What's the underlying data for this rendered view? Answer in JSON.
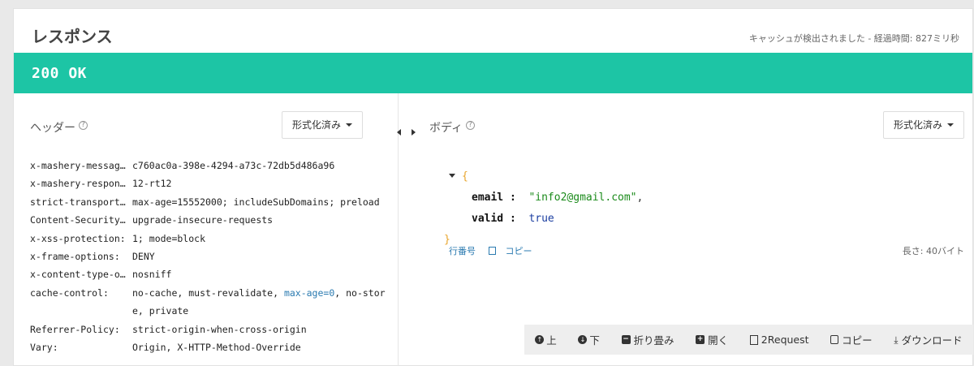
{
  "response": {
    "title": "レスポンス",
    "cache_message": "キャッシュが検出されました - 経過時間: 827ミリ秒",
    "status": "200 OK"
  },
  "headers_section": {
    "label": "ヘッダー",
    "help": "?",
    "format_button": "形式化済み",
    "rows": [
      {
        "key": "x-mashery-messag…",
        "value": "c760ac0a-398e-4294-a73c-72db5d486a96"
      },
      {
        "key": "x-mashery-respon…",
        "value": "12-rt12"
      },
      {
        "key": "strict-transport…",
        "value": "max-age=15552000; includeSubDomains; preload"
      },
      {
        "key": "Content-Security…",
        "value": "upgrade-insecure-requests"
      },
      {
        "key": "x-xss-protection:",
        "value": "1; mode=block"
      },
      {
        "key": "x-frame-options:",
        "value": "DENY"
      },
      {
        "key": "x-content-type-o…",
        "value": "nosniff"
      },
      {
        "key": "cache-control:",
        "value_a": "no-cache, must-revalidate, ",
        "value_hl": "max-age=0",
        "value_b": ", no-store, private"
      },
      {
        "key": "Referrer-Policy:",
        "value": "strict-origin-when-cross-origin"
      },
      {
        "key": "Vary:",
        "value": "Origin, X-HTTP-Method-Override"
      }
    ]
  },
  "body_section": {
    "label": "ボディ",
    "help": "?",
    "format_button": "形式化済み",
    "json": {
      "open_brace": "{",
      "close_brace": "}",
      "email_key": "email",
      "email_value": "\"info2@gmail.com\"",
      "valid_key": "valid",
      "valid_value": "true"
    },
    "line_numbers_link": "行番号",
    "copy_link": "コピー",
    "length": "長さ: 40バイト"
  },
  "toolbar": {
    "up": "上",
    "down": "下",
    "collapse": "折り畳み",
    "open": "開く",
    "to_request": "2Request",
    "copy": "コピー",
    "download": "ダウンロード"
  }
}
